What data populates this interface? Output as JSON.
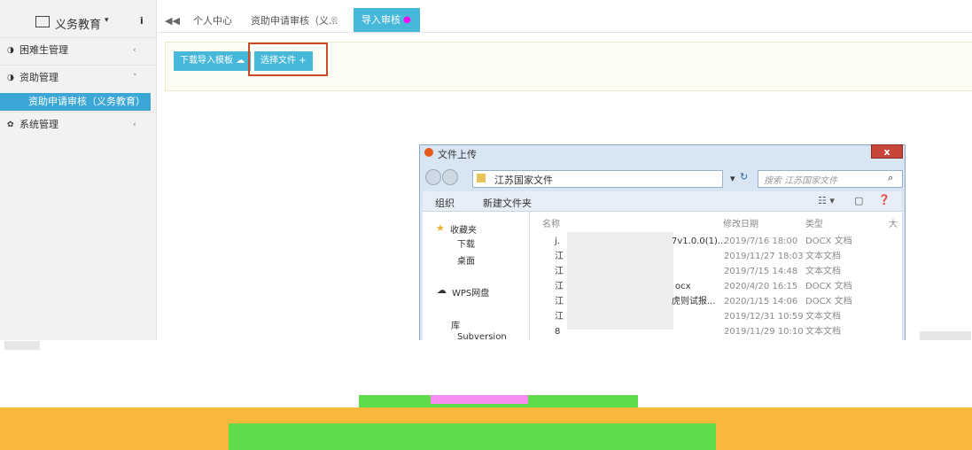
{
  "sidebar": {
    "brand": "义务教育",
    "items": [
      {
        "label": "困难生管理"
      },
      {
        "label": "资助管理"
      },
      {
        "label": "系统管理"
      }
    ],
    "active_sub": "资助申请审核（义务教育）"
  },
  "tabs": {
    "t1": "个人中心",
    "t2": "资助申请审核（义...",
    "t3": "导入审核"
  },
  "toolbar": {
    "download": "下载导入模板",
    "choose": "选择文件"
  },
  "dialog": {
    "title": "文件上传",
    "breadcrumb": "江苏国家文件",
    "search_placeholder": "搜索 江苏国家文件",
    "organize": "组织",
    "new_folder": "新建文件夹",
    "nav": [
      "收藏夹",
      "下载",
      "桌面",
      "WPS网盘",
      "库",
      "Subversion"
    ],
    "columns": [
      "名称",
      "修改日期",
      "类型",
      "大"
    ],
    "files": [
      {
        "name": "j.",
        "mid": "7v1.0.0(1)...",
        "date": "2019/7/16 18:00",
        "type": "DOCX 文档"
      },
      {
        "name": "江",
        "mid": "",
        "date": "2019/11/27 18:03",
        "type": "文本文档"
      },
      {
        "name": "江",
        "mid": "",
        "date": "2019/7/15 14:48",
        "type": "文本文档"
      },
      {
        "name": "江",
        "mid": "ocx",
        "date": "2020/4/20 16:15",
        "type": "DOCX 文档"
      },
      {
        "name": "江",
        "mid": "虎则试报...",
        "date": "2020/1/15 14:06",
        "type": "DOCX 文档"
      },
      {
        "name": "江",
        "mid": "",
        "date": "2019/12/31 10:59",
        "type": "文本文档"
      },
      {
        "name": "8",
        "mid": "",
        "date": "2019/11/29 10:10",
        "type": "文本文档"
      }
    ]
  },
  "colors": {
    "accent": "#46b8da",
    "highlight": "#cc4a2a"
  }
}
